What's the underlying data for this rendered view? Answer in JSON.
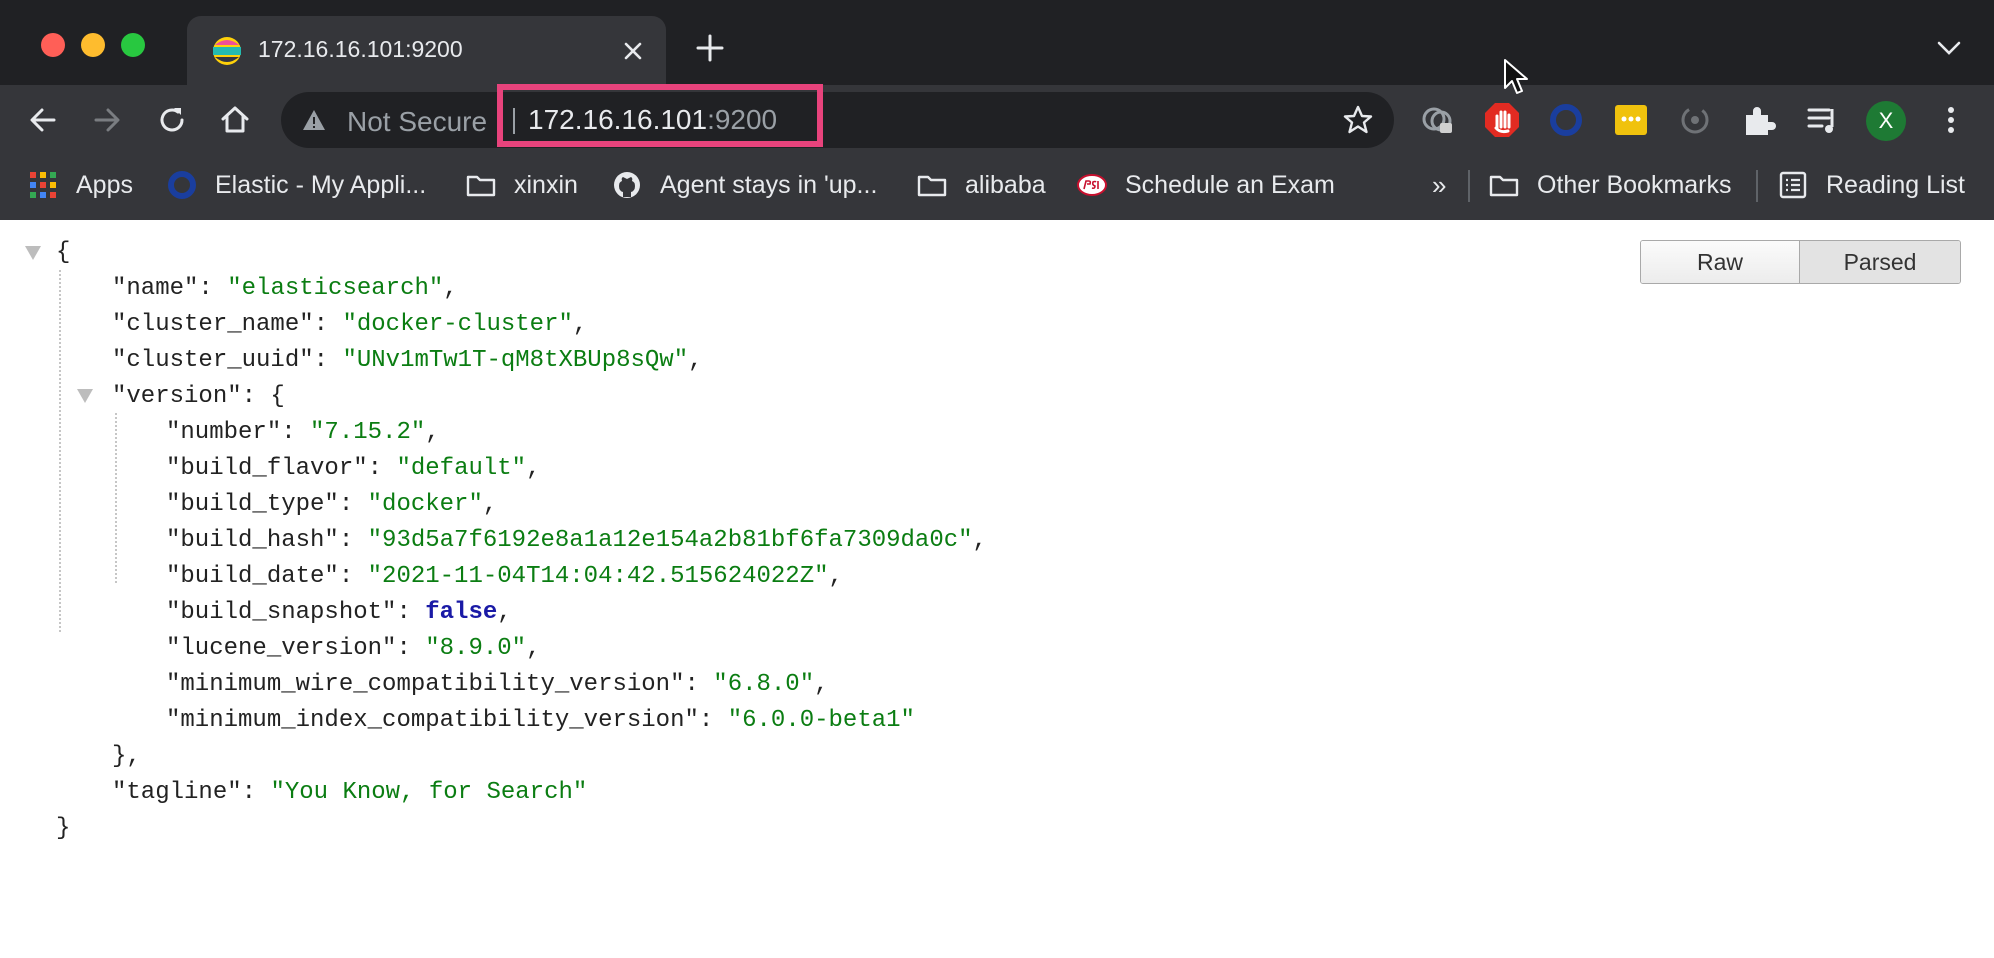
{
  "tab": {
    "title": "172.16.16.101:9200"
  },
  "omnibox": {
    "security_label": "Not Secure",
    "host": "172.16.16.101",
    "port": ":9200"
  },
  "bookmarks": {
    "items": [
      {
        "label": "Apps",
        "icon": "apps-grid-icon"
      },
      {
        "label": "Elastic - My Appli...",
        "icon": "elastic-icon"
      },
      {
        "label": "xinxin",
        "icon": "folder-icon"
      },
      {
        "label": "Agent stays in 'up...",
        "icon": "github-icon"
      },
      {
        "label": "alibaba",
        "icon": "folder-icon"
      },
      {
        "label": "Schedule an Exam",
        "icon": "psi-icon"
      }
    ],
    "overflow": "»",
    "other": "Other Bookmarks",
    "reading_list": "Reading List"
  },
  "profile": {
    "initial": "X",
    "color": "#1e7a34"
  },
  "viewer": {
    "raw_label": "Raw",
    "parsed_label": "Parsed"
  },
  "json": {
    "open_brace": "{",
    "close_brace": "}",
    "name": {
      "key": "\"name\"",
      "value": "\"elasticsearch\""
    },
    "cluster_name": {
      "key": "\"cluster_name\"",
      "value": "\"docker-cluster\""
    },
    "cluster_uuid": {
      "key": "\"cluster_uuid\"",
      "value": "\"UNv1mTw1T-qM8tXBUp8sQw\""
    },
    "version_key": "\"version\"",
    "version": {
      "number": {
        "key": "\"number\"",
        "value": "\"7.15.2\""
      },
      "build_flavor": {
        "key": "\"build_flavor\"",
        "value": "\"default\""
      },
      "build_type": {
        "key": "\"build_type\"",
        "value": "\"docker\""
      },
      "build_hash": {
        "key": "\"build_hash\"",
        "value": "\"93d5a7f6192e8a1a12e154a2b81bf6fa7309da0c\""
      },
      "build_date": {
        "key": "\"build_date\"",
        "value": "\"2021-11-04T14:04:42.515624022Z\""
      },
      "build_snapshot": {
        "key": "\"build_snapshot\"",
        "value": "false"
      },
      "lucene_version": {
        "key": "\"lucene_version\"",
        "value": "\"8.9.0\""
      },
      "min_wire": {
        "key": "\"minimum_wire_compatibility_version\"",
        "value": "\"6.8.0\""
      },
      "min_index": {
        "key": "\"minimum_index_compatibility_version\"",
        "value": "\"6.0.0-beta1\""
      }
    },
    "version_close": "},",
    "tagline": {
      "key": "\"tagline\"",
      "value": "\"You Know, for Search\""
    }
  },
  "colors": {
    "highlight": "#e8437c",
    "string": "#0b7d12",
    "boolean": "#1a1aa6"
  }
}
